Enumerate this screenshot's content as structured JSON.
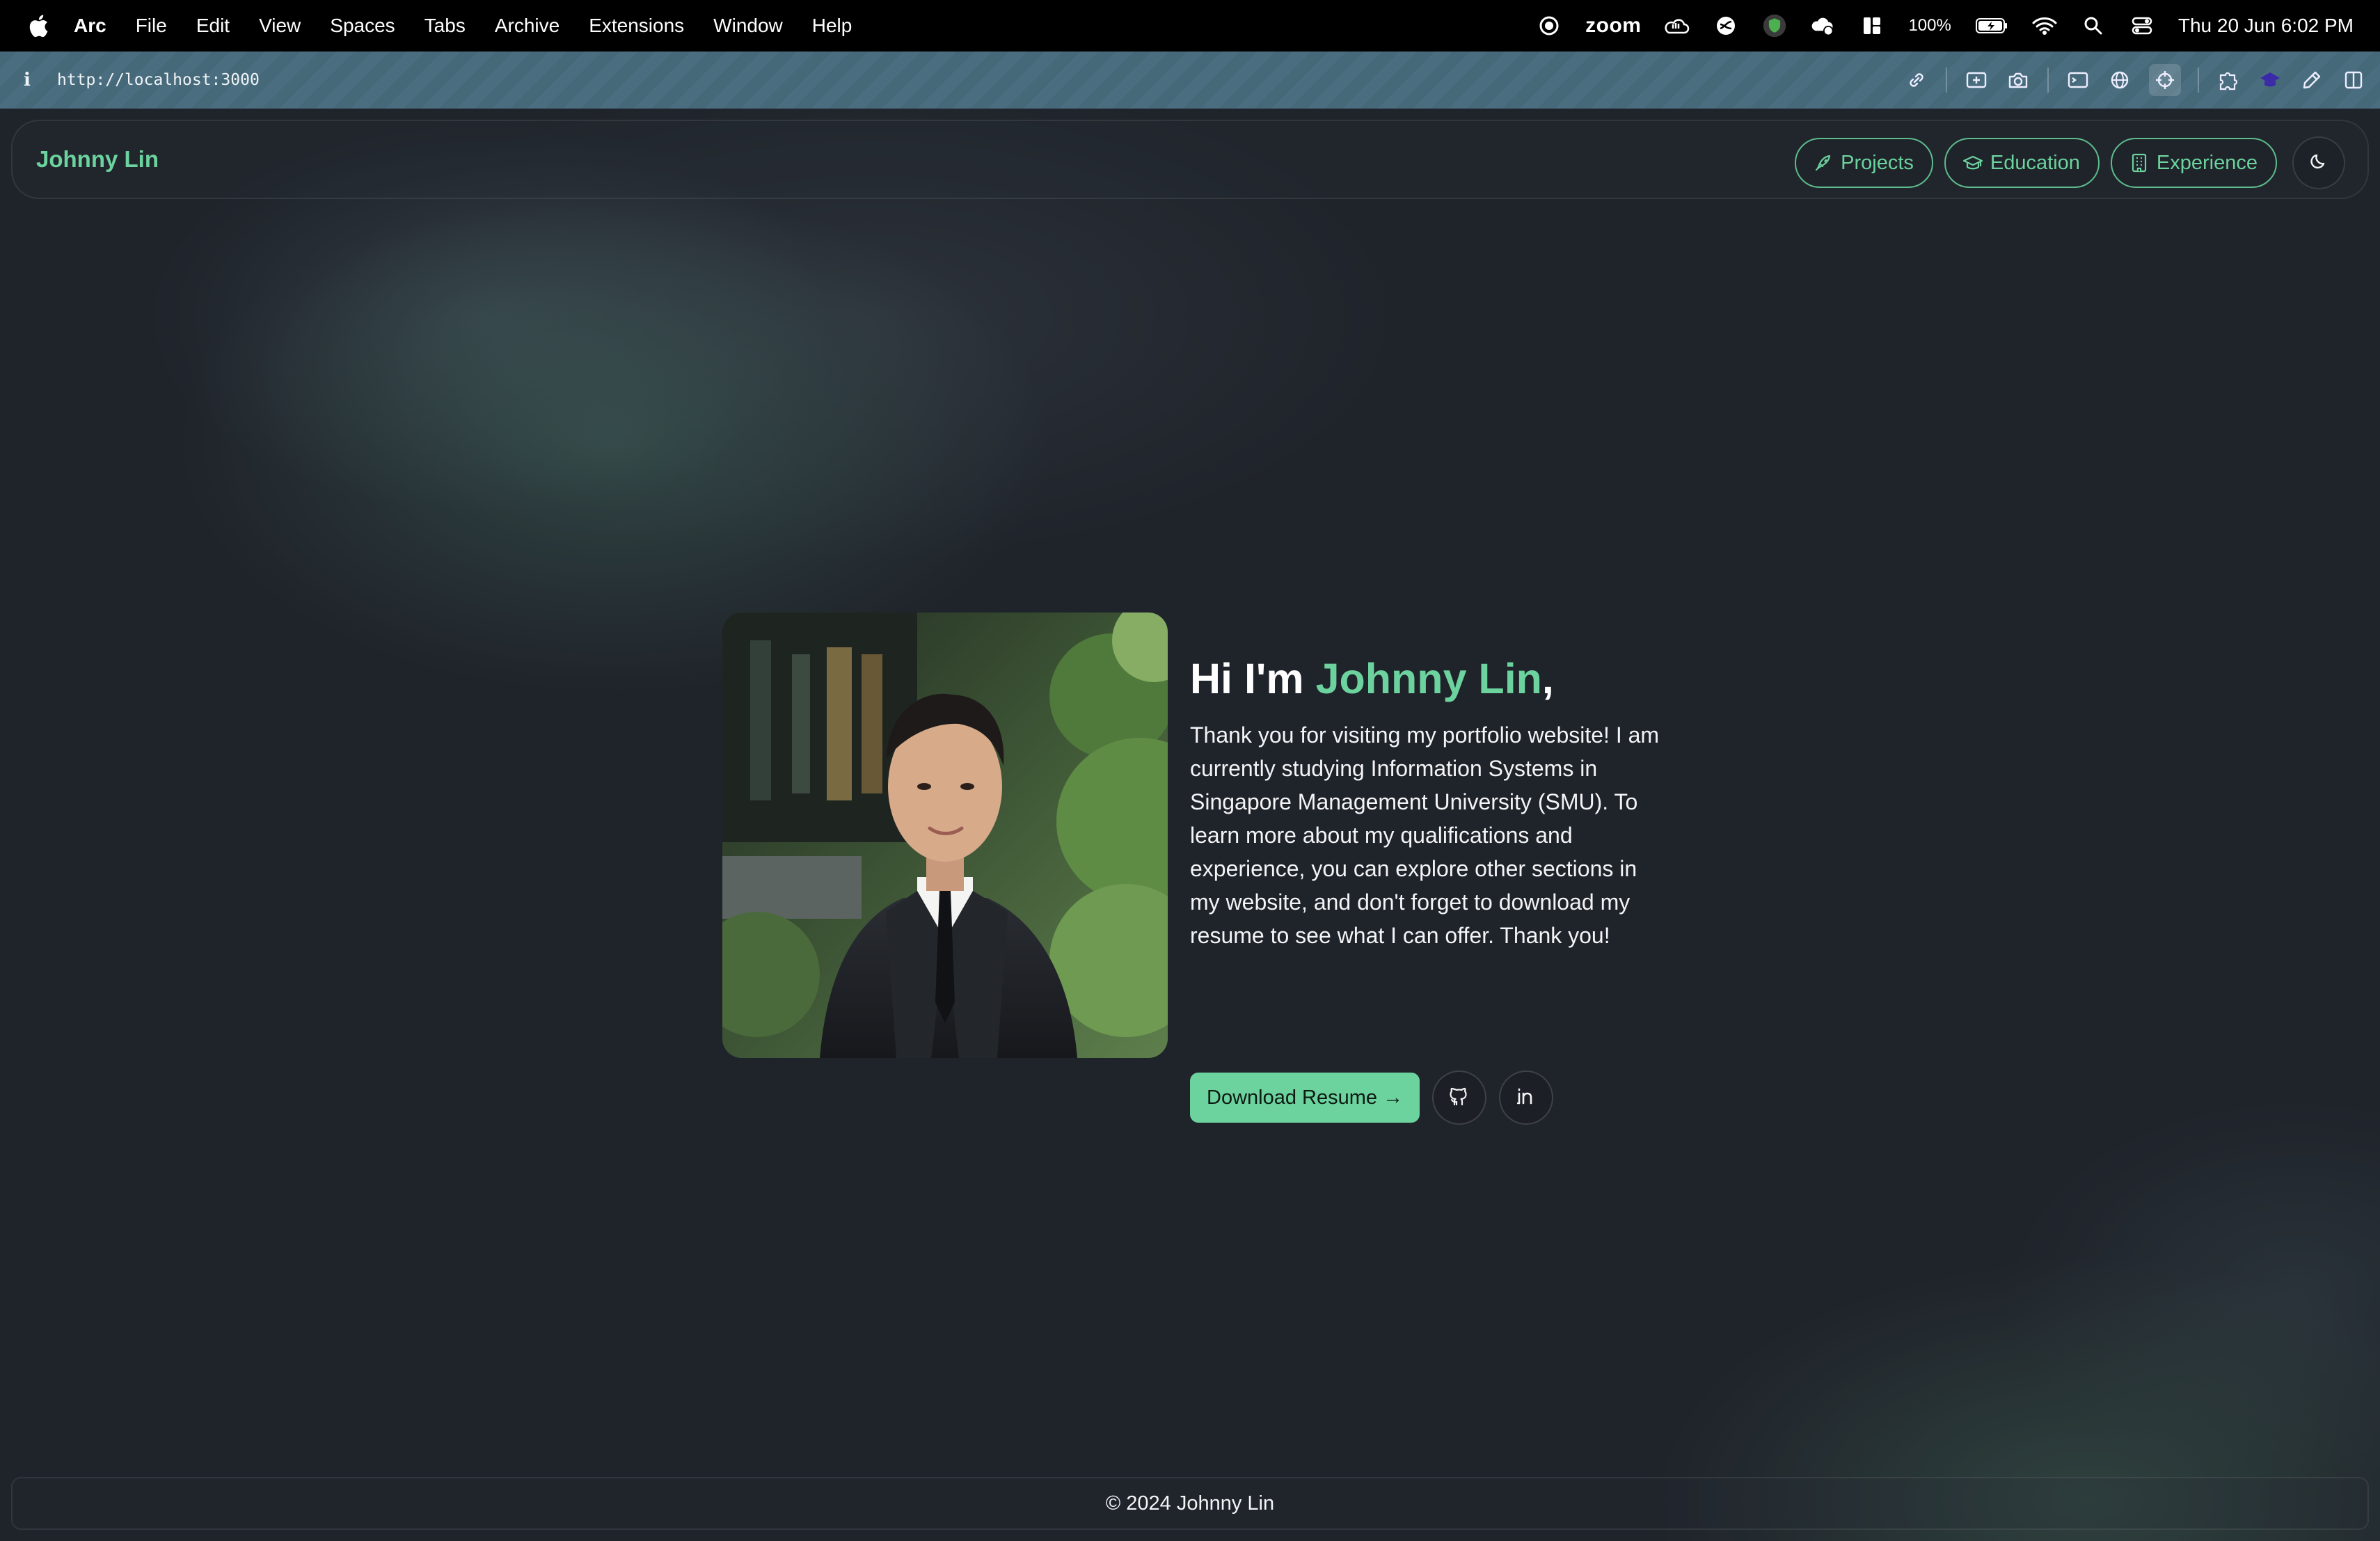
{
  "menubar": {
    "app_name": "Arc",
    "menus": [
      "File",
      "Edit",
      "View",
      "Spaces",
      "Tabs",
      "Archive",
      "Extensions",
      "Window",
      "Help"
    ],
    "zoom_label": "zoom",
    "battery": "100%",
    "datetime": "Thu 20 Jun  6:02 PM"
  },
  "browser": {
    "url": "http://localhost:3000",
    "info_glyph": "i"
  },
  "site": {
    "brand": "Johnny Lin",
    "nav": [
      {
        "label": "Projects",
        "icon": "rocket-icon"
      },
      {
        "label": "Education",
        "icon": "graduation-cap-icon"
      },
      {
        "label": "Experience",
        "icon": "building-icon"
      }
    ],
    "theme_toggle_icon": "moon-icon",
    "accent_color": "#6cd29e",
    "background_color": "#1f232a"
  },
  "hero": {
    "greeting": "Hi I'm ",
    "name": "Johnny Lin",
    "comma": ",",
    "description": "Thank you for visiting my portfolio website! I am currently studying Information Systems in Singapore Management University (SMU). To learn more about my qualifications and experience, you can explore other sections in my website, and don't forget to download my resume to see what I can offer. Thank you!",
    "download_label": "Download Resume →",
    "github_icon": "github-icon",
    "linkedin_icon": "linkedin-icon"
  },
  "footer": {
    "text": "© 2024 Johnny Lin"
  }
}
